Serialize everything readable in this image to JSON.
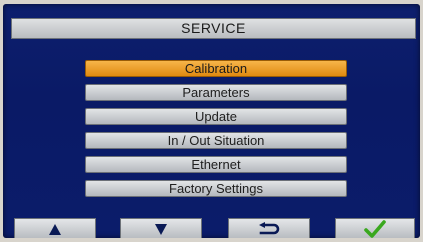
{
  "header": {
    "title": "SERVICE"
  },
  "menu": {
    "items": [
      {
        "label": "Calibration",
        "selected": true
      },
      {
        "label": "Parameters",
        "selected": false
      },
      {
        "label": "Update",
        "selected": false
      },
      {
        "label": "In / Out Situation",
        "selected": false
      },
      {
        "label": "Ethernet",
        "selected": false
      },
      {
        "label": "Factory Settings",
        "selected": false
      }
    ]
  },
  "toolbar": {
    "buttons": [
      {
        "name": "up",
        "icon": "arrow-up-icon"
      },
      {
        "name": "down",
        "icon": "arrow-down-icon"
      },
      {
        "name": "back",
        "icon": "return-icon"
      },
      {
        "name": "confirm",
        "icon": "checkmark-icon"
      }
    ]
  },
  "colors": {
    "screen_background": "#0b1c6a",
    "selected_item": "#f0a030",
    "button_face": "#c8cbcf",
    "arrow_color": "#0a1a55",
    "check_color": "#3aa81e"
  }
}
